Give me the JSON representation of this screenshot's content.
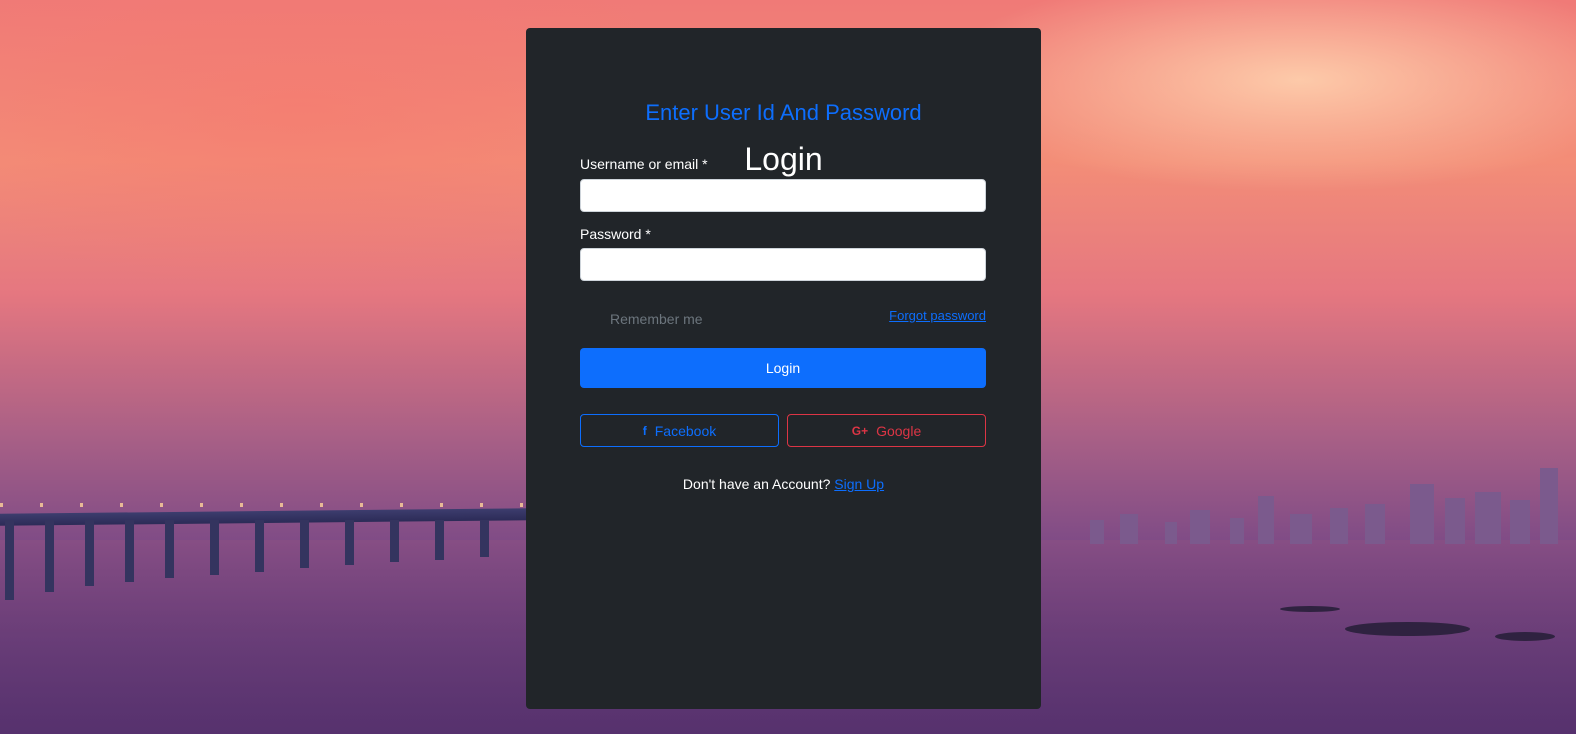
{
  "login_card": {
    "subtitle": "Enter User Id And Password",
    "title": "Login",
    "username_label": "Username or email *",
    "username_value": "",
    "password_label": "Password *",
    "password_value": "",
    "remember_label": "Remember me",
    "forgot_link": "Forgot password",
    "login_button": "Login",
    "facebook_button": "Facebook",
    "google_button": "Google",
    "signup_prompt": "Don't have an Account?",
    "signup_link": "Sign Up"
  },
  "icons": {
    "facebook": "facebook-icon",
    "google": "google-plus-icon"
  },
  "colors": {
    "card_background": "#212529",
    "accent_blue": "#0d6efd",
    "google_red": "#dc3545"
  }
}
